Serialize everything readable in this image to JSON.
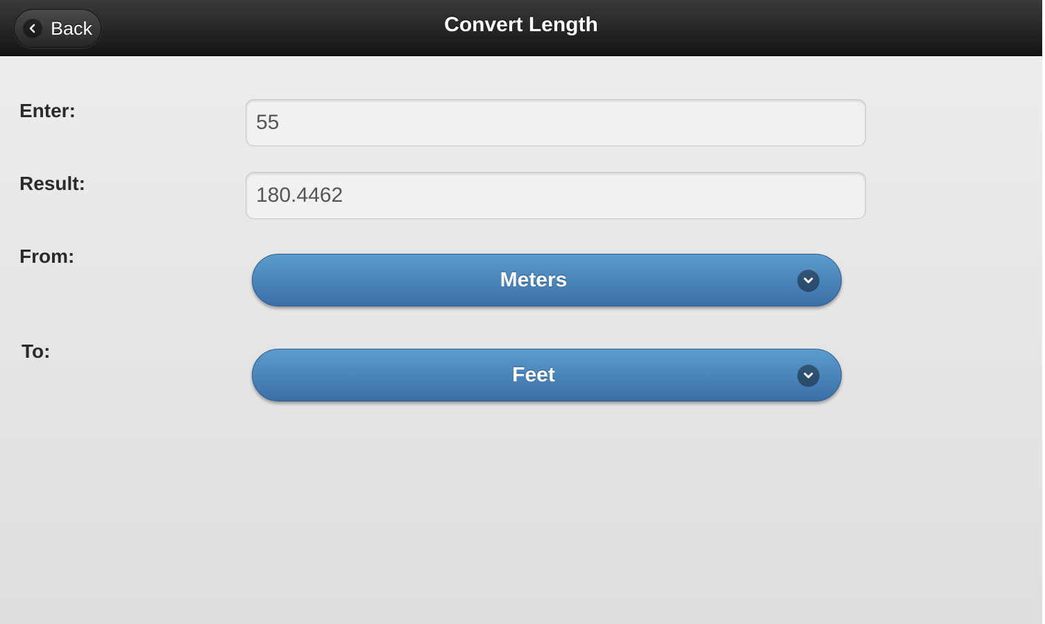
{
  "header": {
    "title": "Convert Length",
    "back_label": "Back",
    "back_icon": "chevron-left-icon"
  },
  "form": {
    "enter_label": "Enter:",
    "enter_value": "55",
    "result_label": "Result:",
    "result_value": "180.4462",
    "from_label": "From:",
    "from_selected": "Meters",
    "to_label": "To:",
    "to_selected": "Feet",
    "dropdown_icon": "chevron-down-icon"
  },
  "colors": {
    "header_bg": "#1e1e1e",
    "select_bg": "#4a86bd",
    "page_bg": "#e6e6e6"
  }
}
